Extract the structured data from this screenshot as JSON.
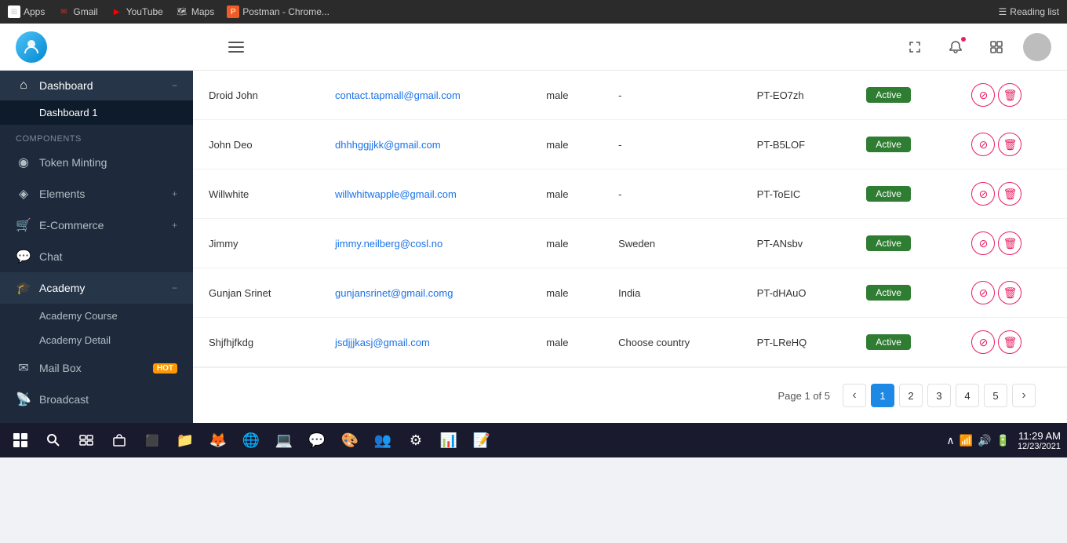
{
  "browser": {
    "tabs": [
      {
        "id": "apps",
        "label": "Apps",
        "favicon": "⊞"
      },
      {
        "id": "gmail",
        "label": "Gmail",
        "favicon": "✉"
      },
      {
        "id": "youtube",
        "label": "YouTube",
        "favicon": "▶"
      },
      {
        "id": "maps",
        "label": "Maps",
        "favicon": "🗺"
      },
      {
        "id": "postman",
        "label": "Postman - Chrome...",
        "favicon": "P"
      }
    ],
    "reading_list": "Reading list"
  },
  "header": {
    "hamburger_label": "menu"
  },
  "sidebar": {
    "items": [
      {
        "id": "dashboard",
        "label": "Dashboard",
        "icon": "⌂",
        "has_arrow": true,
        "active": true
      },
      {
        "id": "dashboard-1",
        "label": "Dashboard 1",
        "type": "sub",
        "active": true
      },
      {
        "id": "components-label",
        "label": "Components",
        "type": "section"
      },
      {
        "id": "token-minting",
        "label": "Token Minting",
        "icon": "◉"
      },
      {
        "id": "elements",
        "label": "Elements",
        "icon": "◈",
        "has_plus": true
      },
      {
        "id": "ecommerce",
        "label": "E-Commerce",
        "icon": "🛒",
        "has_plus": true
      },
      {
        "id": "chat",
        "label": "Chat",
        "icon": "💬"
      },
      {
        "id": "academy",
        "label": "Academy",
        "icon": "🎓",
        "has_arrow": true,
        "active": true
      },
      {
        "id": "academy-course",
        "label": "Academy Course",
        "type": "sub"
      },
      {
        "id": "academy-detail",
        "label": "Academy Detail",
        "type": "sub"
      },
      {
        "id": "mailbox",
        "label": "Mail Box",
        "icon": "✉",
        "hot": true
      },
      {
        "id": "broadcast",
        "label": "Broadcast",
        "icon": "📡"
      }
    ]
  },
  "table": {
    "rows": [
      {
        "name": "Droid John",
        "email": "contact.tapmall@gmail.com",
        "gender": "male",
        "country": "-",
        "code": "PT-EO7zh",
        "status": "Active"
      },
      {
        "name": "John Deo",
        "email": "dhhhggjjkk@gmail.com",
        "gender": "male",
        "country": "-",
        "code": "PT-B5LOF",
        "status": "Active"
      },
      {
        "name": "Willwhite",
        "email": "willwhitwapple@gmail.com",
        "gender": "male",
        "country": "-",
        "code": "PT-ToEIC",
        "status": "Active"
      },
      {
        "name": "Jimmy",
        "email": "jimmy.neilberg@cosl.no",
        "gender": "male",
        "country": "Sweden",
        "code": "PT-ANsbv",
        "status": "Active"
      },
      {
        "name": "Gunjan Srinet",
        "email": "gunjansrinet@gmail.comg",
        "gender": "male",
        "country": "India",
        "code": "PT-dHAuO",
        "status": "Active"
      },
      {
        "name": "Shjfhjfkdg",
        "email": "jsdjjjkasj@gmail.com",
        "gender": "male",
        "country": "Choose country",
        "code": "PT-LReHQ",
        "status": "Active"
      }
    ]
  },
  "pagination": {
    "label": "Page 1 of 5",
    "current": 1,
    "pages": [
      1,
      2,
      3,
      4,
      5
    ]
  },
  "taskbar": {
    "time": "11:29 AM",
    "date": "12/23/2021"
  }
}
